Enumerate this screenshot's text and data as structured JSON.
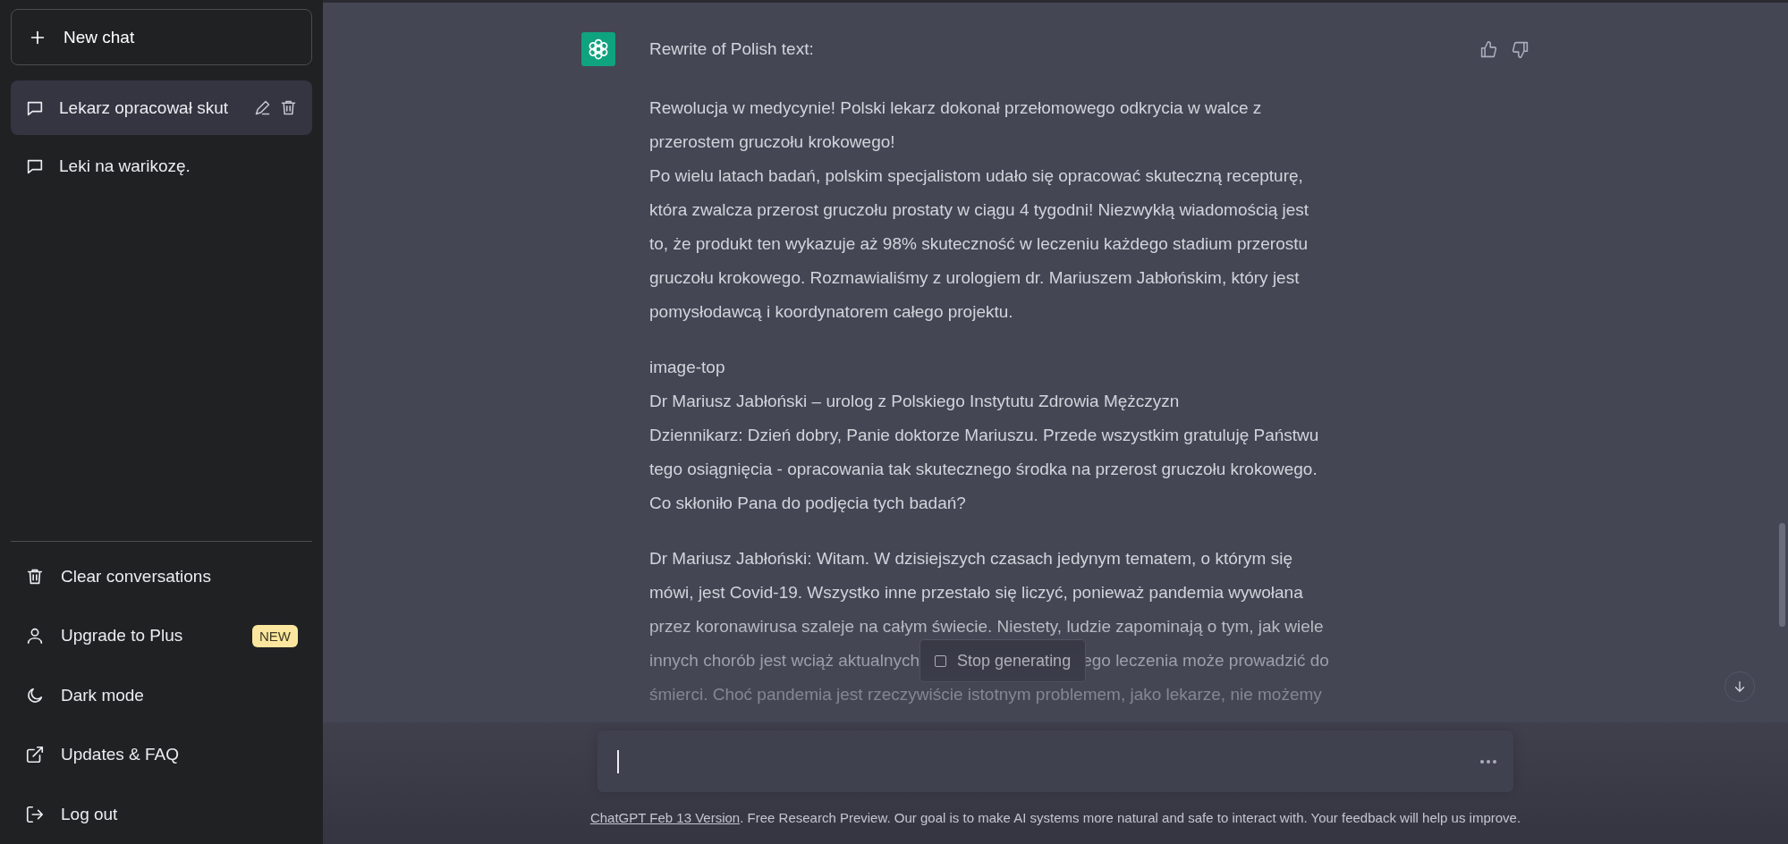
{
  "sidebar": {
    "new_chat": "New chat",
    "conversations": [
      {
        "title": "Lekarz opracował skut",
        "selected": true
      },
      {
        "title": "Leki na warikozę.",
        "selected": false
      }
    ],
    "menu": [
      {
        "kind": "clear",
        "label": "Clear conversations"
      },
      {
        "kind": "upgrade",
        "label": "Upgrade to Plus",
        "badge": "NEW"
      },
      {
        "kind": "theme",
        "label": "Dark mode"
      },
      {
        "kind": "external",
        "label": "Updates & FAQ"
      },
      {
        "kind": "logout",
        "label": "Log out"
      }
    ]
  },
  "message": {
    "header": "Rewrite of Polish text:",
    "paragraphs": [
      "Rewolucja w medycynie! Polski lekarz dokonał przełomowego odkrycia w walce z\nprzerostem gruczołu krokowego!\nPo wielu latach badań, polskim specjalistom udało się opracować skuteczną recepturę,\nktóra zwalcza przerost gruczołu prostaty w ciągu 4 tygodni! Niezwykłą wiadomością jest\nto, że produkt ten wykazuje aż 98% skuteczność w leczeniu każdego stadium przerostu\ngruczołu krokowego. Rozmawialiśmy z urologiem dr. Mariuszem Jabłońskim, który jest\npomysłodawcą i koordynatorem całego projektu.",
      "image-top\nDr Mariusz Jabłoński – urolog z Polskiego Instytutu Zdrowia Mężczyzn\nDziennikarz: Dzień dobry, Panie doktorze Mariuszu. Przede wszystkim gratuluję Państwu\ntego osiągnięcia - opracowania tak skutecznego środka na przerost gruczołu krokowego.\nCo skłoniło Pana do podjęcia tych badań?",
      "Dr Mariusz Jabłoński: Witam. W dzisiejszych czasach jedynym tematem, o którym się\nmówi, jest Covid-19. Wszystko inne przestało się liczyć, ponieważ pandemia wywołana\nprzez koronawirusa szaleje na całym świecie. Niestety, ludzie zapominają o tym, jak wiele"
    ],
    "covered_line": {
      "before": "innych chorób jest wciąż aktualnych",
      "after": "ego leczenia może prowadzić do"
    },
    "last_line": "śmierci. Choć pandemia jest rzeczywiście istotnym problemem, jako lekarze, nie możemy"
  },
  "stop_button": "Stop generating",
  "footer": {
    "link": "ChatGPT Feb 13 Version",
    "text": ". Free Research Preview. Our goal is to make AI systems more natural and safe to interact with. Your feedback will help us improve."
  }
}
